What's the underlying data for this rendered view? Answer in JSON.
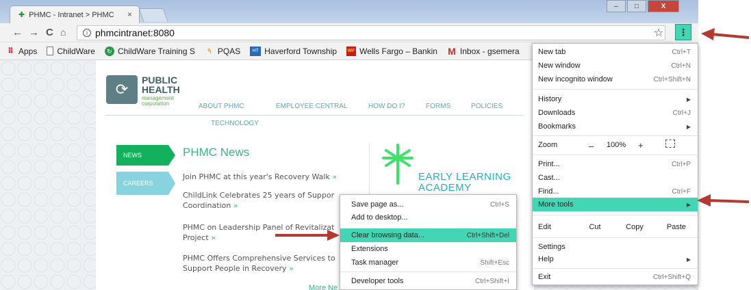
{
  "browser": {
    "tab_title": "PHMC - Intranet > PHMC",
    "tab_close": "×",
    "address": "phmcintranet:8080",
    "info_glyph": "i",
    "menu_glyph": "⋮",
    "back_glyph": "←",
    "forward_glyph": "→",
    "reload_glyph": "C",
    "home_glyph": "⌂",
    "star_glyph": "☆",
    "win_min": "–",
    "win_max": "□",
    "win_close": "X"
  },
  "bookmarks": [
    {
      "label": "Apps",
      "icon": "apps-grid-icon"
    },
    {
      "label": "ChildWare",
      "icon": "page-icon"
    },
    {
      "label": "ChildWare Training S",
      "icon": "childware-training-icon"
    },
    {
      "label": "PQAS",
      "icon": "pqas-icon"
    },
    {
      "label": "Haverford Township",
      "icon": "haverford-icon"
    },
    {
      "label": "Wells Fargo – Bankin",
      "icon": "wells-fargo-icon"
    },
    {
      "label": "Inbox - gsemera",
      "icon": "gmail-icon"
    }
  ],
  "bookmark_icon_glyphs": {
    "apps": "⠿",
    "childware_training": "↻",
    "pqas": "٩",
    "haverford": "HT",
    "wells_fargo": "WF",
    "gmail": "M"
  },
  "site": {
    "logo": {
      "line1": "PUBLIC",
      "line2": "HEALTH",
      "line3": "management",
      "line4": "corporation",
      "mark": "⟳"
    },
    "nav": [
      "ABOUT PHMC",
      "EMPLOYEE CENTRAL",
      "HOW DO I?",
      "FORMS",
      "POLICIES",
      "TECHNOLOGY"
    ],
    "tabs": {
      "news": "NEWS",
      "careers": "CAREERS"
    },
    "news_title": "PHMC News",
    "news_items": [
      {
        "text": "Join PHMC at this year's Recovery Walk",
        "link": "»"
      },
      {
        "text": "ChildLink Celebrates 25 years of Suppor Coordination",
        "link": "»"
      },
      {
        "text": "PHMC on Leadership Panel of Revitalizat Project",
        "link": "»"
      },
      {
        "text": "PHMC Offers Comprehensive Services to Support People in Recovery",
        "link": "»"
      }
    ],
    "more_news": "More Ne",
    "ela_line1": "EARLY LEARNING",
    "ela_line2": "ACADEMY"
  },
  "main_menu": {
    "items": [
      {
        "label": "New tab",
        "shortcut": "Ctrl+T"
      },
      {
        "label": "New window",
        "shortcut": "Ctrl+N"
      },
      {
        "label": "New incognito window",
        "shortcut": "Ctrl+Shift+N"
      },
      {
        "label": "History",
        "shortcut": "▶"
      },
      {
        "label": "Downloads",
        "shortcut": "Ctrl+J"
      },
      {
        "label": "Bookmarks",
        "shortcut": "▶"
      },
      {
        "label": "Zoom",
        "shortcut": ""
      },
      {
        "label": "Print...",
        "shortcut": "Ctrl+P"
      },
      {
        "label": "Cast...",
        "shortcut": ""
      },
      {
        "label": "Find...",
        "shortcut": "Ctrl+F"
      },
      {
        "label": "More tools",
        "shortcut": "▶"
      },
      {
        "label": "Edit",
        "shortcut": ""
      },
      {
        "label": "Settings",
        "shortcut": ""
      },
      {
        "label": "Help",
        "shortcut": "▶"
      },
      {
        "label": "Exit",
        "shortcut": "Ctrl+Shift+Q"
      }
    ],
    "zoom": {
      "minus": "–",
      "value": "100%",
      "plus": "+"
    },
    "edit": {
      "cut": "Cut",
      "copy": "Copy",
      "paste": "Paste"
    }
  },
  "sub_menu": {
    "items": [
      {
        "label": "Save page as...",
        "shortcut": "Ctrl+S"
      },
      {
        "label": "Add to desktop...",
        "shortcut": ""
      },
      {
        "label": "Clear browsing data...",
        "shortcut": "Ctrl+Shift+Del"
      },
      {
        "label": "Extensions",
        "shortcut": ""
      },
      {
        "label": "Task manager",
        "shortcut": "Shift+Esc"
      },
      {
        "label": "Developer tools",
        "shortcut": "Ctrl+Shift+I"
      }
    ]
  },
  "colors": {
    "menu_highlight": "#43d6b4",
    "arrow": "#b23a30",
    "news_green": "#13b05e",
    "careers_blue": "#88d3df",
    "accent_teal": "#1fb0c4"
  }
}
